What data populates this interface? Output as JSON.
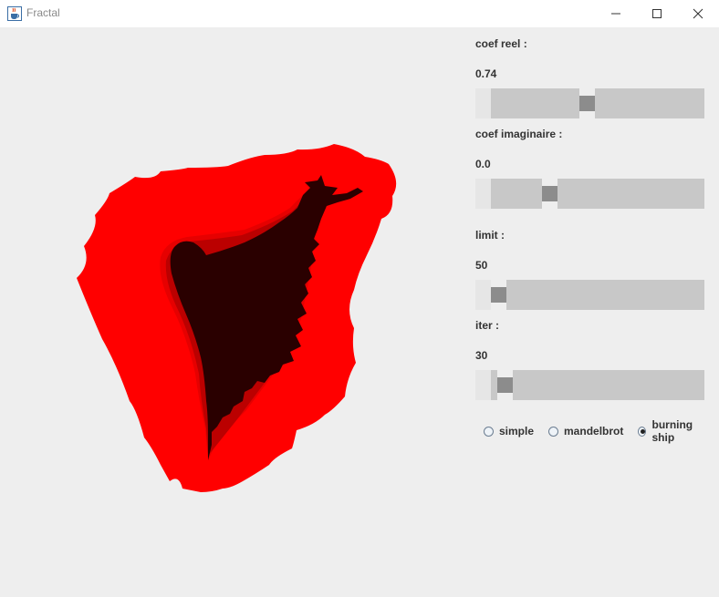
{
  "window": {
    "title": "Fractal",
    "icon": "java-cup-icon"
  },
  "controls": {
    "coef_reel": {
      "label": "coef reel :",
      "value": "0.74",
      "slider_fraction": 0.44
    },
    "coef_imaginaire": {
      "label": "coef imaginaire :",
      "value": "0.0",
      "slider_fraction": 0.25
    },
    "limit": {
      "label": "limit :",
      "value": "50",
      "slider_fraction": 0.0
    },
    "iter": {
      "label": "iter :",
      "value": "30",
      "slider_fraction": 0.03
    }
  },
  "modes": [
    {
      "label": "simple",
      "checked": false
    },
    {
      "label": "mandelbrot",
      "checked": false
    },
    {
      "label": "burning ship",
      "checked": true
    }
  ],
  "colors": {
    "fractal_outer": "#ff0000",
    "fractal_mid": "#e60000",
    "fractal_inner": "#bb0000",
    "fractal_core": "#2a0000"
  }
}
